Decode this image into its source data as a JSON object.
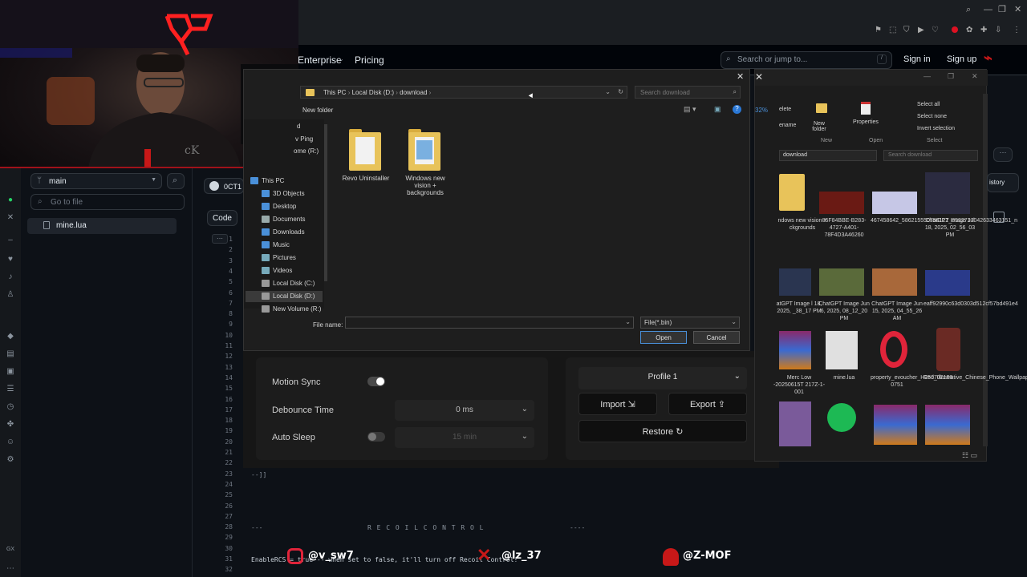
{
  "github": {
    "nav": [
      "Enterprise",
      "Pricing"
    ],
    "search_placeholder": "Search or jump to...",
    "search_key": "/",
    "sign_in": "Sign in",
    "sign_up": "Sign up"
  },
  "sidebar": {
    "branch": "main",
    "goto_placeholder": "Go to file",
    "file": "mine.lua"
  },
  "code": {
    "commit_label": "0CT1",
    "tab_code": "Code",
    "line_numbers": [
      "1",
      "2",
      "3",
      "4",
      "5",
      "6",
      "7",
      "8",
      "9",
      "10",
      "11",
      "12",
      "13",
      "14",
      "15",
      "16",
      "17",
      "18",
      "19",
      "20",
      "21",
      "22",
      "23",
      "24",
      "25",
      "26",
      "27",
      "28",
      "29",
      "30",
      "31",
      "32"
    ],
    "line23": "--]]",
    "line28_left": "---",
    "line28_mid": "R E C O I L   C O N T R O L",
    "line28_right": "----",
    "line31": "EnableRCS = true   -- when set to false, it'll turn off Recoil Control!"
  },
  "dialog": {
    "path": [
      "This PC",
      "Local Disk (D:)",
      "download"
    ],
    "search_placeholder": "Search download",
    "new_folder": "New folder",
    "nav_partial": [
      "d",
      "v Ping",
      "ome (R:)"
    ],
    "nav_items": [
      "This PC",
      "3D Objects",
      "Desktop",
      "Documents",
      "Downloads",
      "Music",
      "Pictures",
      "Videos",
      "Local Disk (C:)",
      "Local Disk (D:)",
      "New Volume (R:)"
    ],
    "folders": [
      {
        "name": "Revo Uninstaller"
      },
      {
        "name": "Windows new vision + backgrounds"
      }
    ],
    "file_name_label": "File name:",
    "file_type": "File(*.bin)",
    "open": "Open",
    "cancel": "Cancel",
    "percent": "32%"
  },
  "settings": {
    "motion_sync": "Motion Sync",
    "motion_sync_on": true,
    "debounce_label": "Debounce Time",
    "debounce_value": "0 ms",
    "auto_sleep": "Auto Sleep",
    "auto_sleep_on": false,
    "auto_sleep_value": "15 min",
    "profile": "Profile 1",
    "import": "Import",
    "export": "Export",
    "restore": "Restore"
  },
  "explorer": {
    "ribbon": {
      "delete": "elete",
      "rename": "ename",
      "new_folder": "New folder",
      "properties": "Properties",
      "select_all": "Select all",
      "select_none": "Select none",
      "invert_selection": "Invert selection",
      "groups": [
        "New",
        "Open",
        "Select"
      ]
    },
    "address": "download",
    "search_placeholder": "Search download",
    "history": "istory",
    "items": [
      {
        "caption": "ndows new vision + ckgrounds"
      },
      {
        "caption": "85F84BBE-B283-4727-A401-78F4D3A46260"
      },
      {
        "caption": "467458642_586215550756122_8532717042633463151_n"
      },
      {
        "caption": "ChatGPT Image Jul 18, 2025, 02_56_03 PM"
      },
      {
        "caption": "atGPT Image l 18, 2025, _38_17 PM"
      },
      {
        "caption": "ChatGPT Image Jun 6, 2025, 08_12_20 PM"
      },
      {
        "caption": "ChatGPT Image Jun 15, 2025, 04_55_26 AM"
      },
      {
        "caption": "eaff92990c63d0303d512cf57bd491e4"
      },
      {
        "caption": "Merc Low -20250615T 217Z-1-001"
      },
      {
        "caption": "mine.lua"
      },
      {
        "caption": "property_evoucher_H250702188 0751"
      },
      {
        "caption": "Red_Illustrative_Chinese_Phone_Wallpaper.png"
      }
    ]
  },
  "overlay": {
    "instagram": "@v_sw7",
    "x_handle": "@lz_37",
    "other": "@Z-MOF"
  },
  "colors": {
    "accent_blue": "#4a90d9",
    "neon_red": "#ff2020",
    "dialog_bg": "#1e1e1e",
    "folder_yellow": "#e8c35a"
  }
}
